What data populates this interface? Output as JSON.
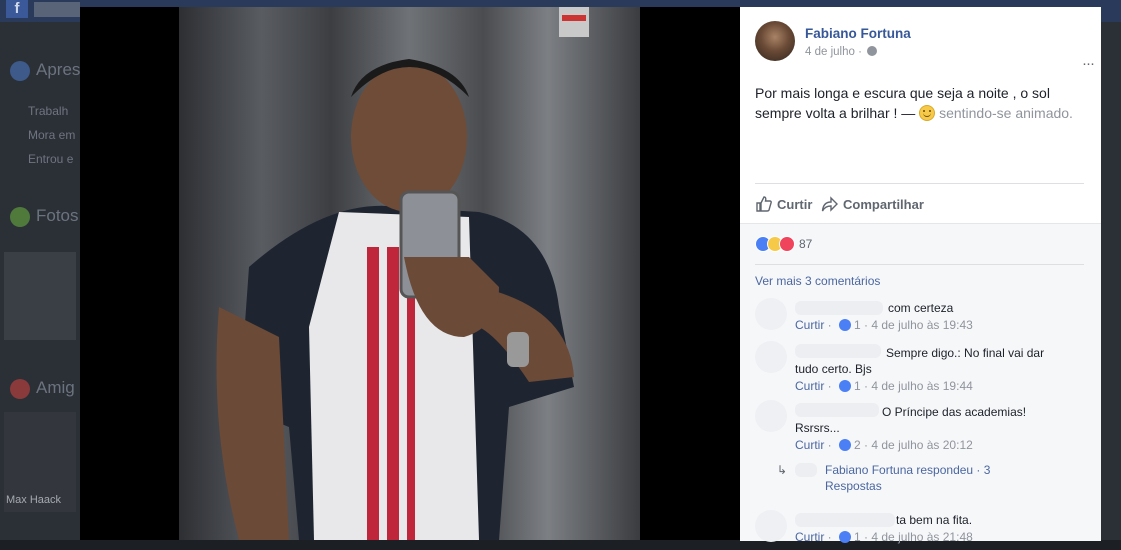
{
  "background": {
    "fb_logo": "f",
    "left_items": [
      {
        "label": "Apres",
        "type": "heading"
      },
      {
        "label": "Trabalh",
        "type": "item"
      },
      {
        "label": "Mora em",
        "type": "item"
      },
      {
        "label": "Entrou e",
        "type": "item"
      },
      {
        "label": "Fotos",
        "type": "heading"
      },
      {
        "label": "Amig",
        "type": "heading"
      }
    ],
    "friend_caption": "Max Haack"
  },
  "post": {
    "author": "Fabiano Fortuna",
    "date": "4 de julho",
    "more_icon": "···",
    "text": "Por mais longa e escura que seja a noite , o sol sempre volta a brilhar ! —",
    "feeling": "sentindo-se animado.",
    "actions": {
      "like": "Curtir",
      "share": "Compartilhar"
    },
    "reactions_count": "87",
    "view_more": "Ver mais 3 comentários"
  },
  "comments": [
    {
      "text": "com certeza",
      "likes": "1",
      "time": "4 de julho às 19:43",
      "like_label": "Curtir"
    },
    {
      "text": "Sempre digo.: No final vai dar tudo certo. Bjs",
      "likes": "1",
      "time": "4 de julho às 19:44",
      "like_label": "Curtir"
    },
    {
      "text": "O Príncipe das academias! Rsrsrs...",
      "likes": "2",
      "time": "4 de julho às 20:12",
      "like_label": "Curtir"
    },
    {
      "text": "ta bem na fita.",
      "likes": "1",
      "time": "4 de julho às 21:48",
      "like_label": "Curtir"
    }
  ],
  "reply": {
    "text": "Fabiano Fortuna respondeu · 3 Respostas"
  },
  "colors": {
    "link": "#365899",
    "meta": "#90949c",
    "like_blue": "#4a7ff5",
    "love_red": "#f0435c"
  }
}
